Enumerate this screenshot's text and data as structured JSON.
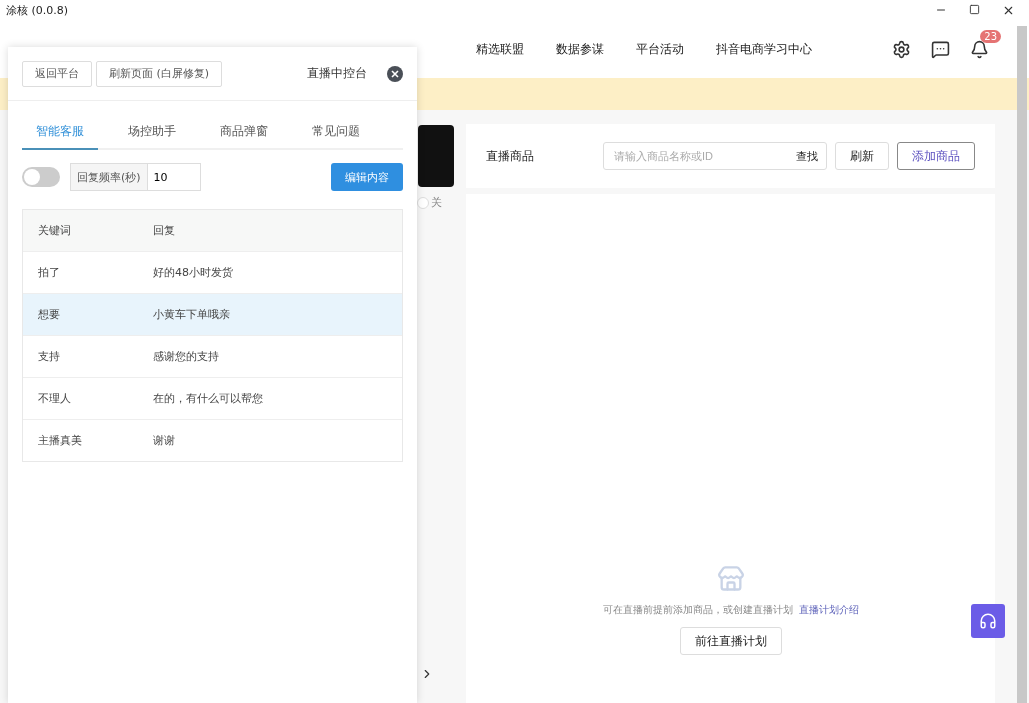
{
  "window": {
    "title": "涂核 (0.0.8)"
  },
  "nav": {
    "items": [
      "精选联盟",
      "数据参谋",
      "平台活动",
      "抖音电商学习中心"
    ],
    "notification_count": "23"
  },
  "background": {
    "toggle_on": false,
    "toggle_label": "关"
  },
  "products": {
    "title": "直播商品",
    "search": {
      "placeholder": "请输入商品名称或ID",
      "button": "查找"
    },
    "refresh": "刷新",
    "add": "添加商品",
    "empty_text": "可在直播前提前添加商品，或创建直播计划",
    "empty_link": "直播计划介绍",
    "plan_button": "前往直播计划"
  },
  "console": {
    "buttons": [
      "返回平台",
      "刷新页面 (白屏修复)"
    ],
    "title": "直播中控台",
    "tabs": [
      {
        "label": "智能客服",
        "selected": true
      },
      {
        "label": "场控助手",
        "selected": false
      },
      {
        "label": "商品弹窗",
        "selected": false
      },
      {
        "label": "常见问题",
        "selected": false
      }
    ],
    "auto_reply": {
      "on": false,
      "frequency_label": "回复频率(秒)",
      "frequency_value": "10",
      "edit_button": "编辑内容"
    },
    "table": {
      "columns": [
        "关键词",
        "回复"
      ],
      "rows": [
        {
          "keyword": "拍了",
          "reply": "好的48小时发货",
          "highlighted": false
        },
        {
          "keyword": "想要",
          "reply": "小黄车下单哦亲",
          "highlighted": true
        },
        {
          "keyword": "支持",
          "reply": "感谢您的支持",
          "highlighted": false
        },
        {
          "keyword": "不理人",
          "reply": "在的，有什么可以帮您",
          "highlighted": false
        },
        {
          "keyword": "主播真美",
          "reply": "谢谢",
          "highlighted": false
        }
      ]
    }
  }
}
